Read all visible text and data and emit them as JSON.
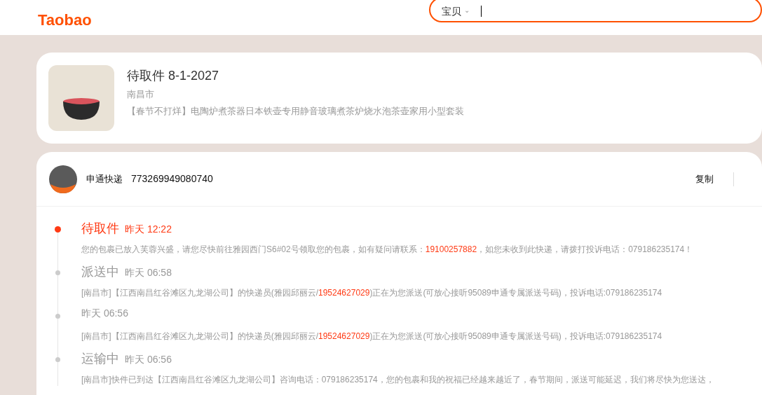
{
  "header": {
    "logo_text": "Taobao",
    "search": {
      "category": "宝贝",
      "caret": "⌄"
    }
  },
  "package": {
    "title": "待取件 8-1-2027",
    "city": "南昌市",
    "product": "【春节不打烊】电陶炉煮茶器日本铁壶专用静音玻璃煮茶炉烧水泡茶壶家用小型套装"
  },
  "shipment": {
    "carrier": "申通快递",
    "tracking_number": "773269949080740",
    "copy_label": "复制"
  },
  "events": [
    {
      "status": "待取件",
      "time": "昨天 12:22",
      "current": true,
      "parts": [
        {
          "text": "您的包裹已放入芙蓉兴盛，请您尽快前往雅园西门S6#02号领取您的包裹，如有疑问请联系：",
          "highlight": false
        },
        {
          "text": "19100257882",
          "highlight": true
        },
        {
          "text": "，如您未收到此快递，请拨打投诉电话：079186235174！",
          "highlight": false
        }
      ]
    },
    {
      "status": "派送中",
      "time": "昨天 06:58",
      "current": false,
      "parts": [
        {
          "text": "[南昌市]【江西南昌红谷滩区九龙湖公司】的快递员(雅园邱丽云/",
          "highlight": false
        },
        {
          "text": "19524627029",
          "highlight": true
        },
        {
          "text": ")正在为您派送(可放心接听95089申通专属派送号码)，投诉电话:079186235174",
          "highlight": false
        }
      ]
    },
    {
      "time": "昨天 06:56",
      "current": false,
      "parts": [
        {
          "text": "[南昌市]【江西南昌红谷滩区九龙湖公司】的快递员(雅园邱丽云/",
          "highlight": false
        },
        {
          "text": "19524627029",
          "highlight": true
        },
        {
          "text": ")正在为您派送(可放心接听95089申通专属派送号码)，投诉电话:079186235174",
          "highlight": false
        }
      ]
    },
    {
      "status": "运输中",
      "time": "昨天 06:56",
      "current": false,
      "parts": [
        {
          "text": "[南昌市]快件已到达【江西南昌红谷滩区九龙湖公司】咨询电话：079186235174，您的包裹和我的祝福已经越来越近了，春节期间，派送可能延迟，我们将尽快为您送达，",
          "highlight": false
        }
      ]
    }
  ]
}
